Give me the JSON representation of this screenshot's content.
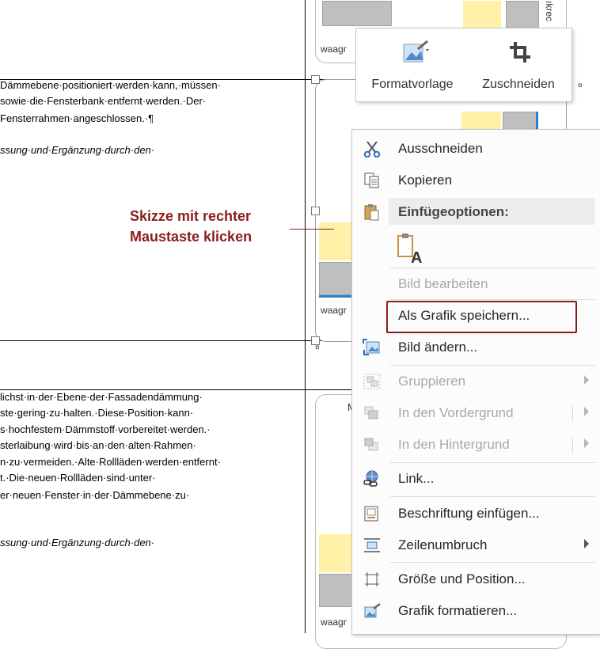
{
  "document": {
    "paragraph1": [
      "Dämmebene·positioniert·werden·kann,·müssen·",
      "sowie·die·Fensterbank·entfernt·werden.·Der·",
      "Fensterrahmen·angeschlossen.·¶"
    ],
    "italic1": "ssung·und·Ergänzung·durch·den·",
    "paragraph2": [
      "lichst·in·der·Ebene·der·Fassadendämmung·",
      "ste·gering·zu·halten.·Diese·Position·kann·",
      "s·hochfestem·Dämmstoff·vorbereitet·werden.·",
      "sterlaibung·wird·bis·an·den·alten·Rahmen·",
      "n·zu·vermeiden.·Alte·Rollläden·werden·entfernt·",
      "t.·Die·neuen·Rollläden·sind·unter·",
      "er·neuen·Fenster·in·der·Dämmebene·zu·"
    ],
    "italic2": "ssung·und·Ergänzung·durch·den·",
    "pilcrow": "¤",
    "sketch_labels": {
      "waag1": "waagr",
      "waag2": "waagr",
      "waag3": "waagr",
      "top_right": "ıkrec",
      "card3_top": "M"
    }
  },
  "annotation": {
    "line1": "Skizze mit rechter",
    "line2": "Maustaste klicken"
  },
  "mini_toolbar": {
    "format_label": "Formatvorlage",
    "crop_label": "Zuschneiden"
  },
  "context_menu": {
    "cut": "Ausschneiden",
    "copy": "Kopieren",
    "paste_header": "Einfügeoptionen:",
    "edit_image": "Bild bearbeiten",
    "save_as_image": "Als Grafik speichern...",
    "change_image": "Bild ändern...",
    "group": "Gruppieren",
    "bring_forward": "In den Vordergrund",
    "send_backward": "In den Hintergrund",
    "link": "Link...",
    "insert_caption": "Beschriftung einfügen...",
    "wrap_text": "Zeilenumbruch",
    "size_position": "Größe und Position...",
    "format_picture": "Grafik formatieren..."
  },
  "colors": {
    "annotation": "#8b1d1d",
    "highlight_border": "#8b1d1d",
    "sketch_yellow": "#fff2a8",
    "sketch_blue": "#2a82d2"
  }
}
